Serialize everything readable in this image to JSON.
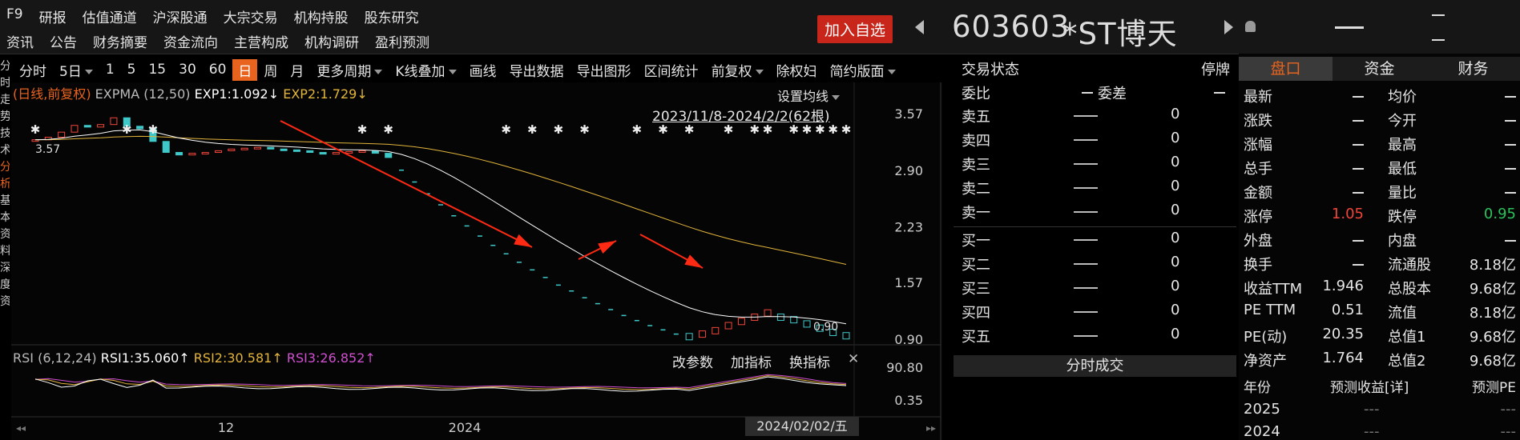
{
  "menu": {
    "row1": [
      "F9",
      "研报",
      "估值通道",
      "沪深股通",
      "大宗交易",
      "机构持股",
      "股东研究"
    ],
    "row2": [
      "资讯",
      "公告",
      "财务摘要",
      "资金流向",
      "主营构成",
      "机构调研",
      "盈利预测"
    ]
  },
  "header": {
    "add_fav": "加入自选",
    "code": "603603",
    "name": "*ST博天"
  },
  "toolbar": {
    "items": [
      "分时",
      "5日",
      "1",
      "5",
      "15",
      "30",
      "60",
      "日",
      "周",
      "月",
      "更多周期",
      "K线叠加",
      "画线",
      "导出数据",
      "导出图形",
      "区间统计",
      "前复权",
      "除权妇",
      "简约版面"
    ],
    "active": "日"
  },
  "side_tabs": [
    "分",
    "时",
    "走",
    "势",
    "技",
    "术",
    "分",
    "析",
    "基",
    "本",
    "资",
    "料",
    "深",
    "度",
    "资"
  ],
  "chart": {
    "k_indicator": {
      "mode": "(日线,前复权)",
      "name": "EXPMA",
      "params": "(12,50)",
      "exp1": "EXP1:1.092↓",
      "exp2": "EXP2:1.729↓"
    },
    "set_ma": "设置均线",
    "range": "2023/11/8-2024/2/2(62根)",
    "price_ticks": [
      "3.57",
      "2.90",
      "2.23",
      "1.57",
      "0.90"
    ],
    "low_label": "0.90",
    "high_label": "3.57",
    "rsi_indicator": {
      "name": "RSI",
      "params": "(6,12,24)",
      "rsi1": "RSI1:35.060↑",
      "rsi2": "RSI2:30.581↑",
      "rsi3": "RSI3:26.852↑"
    },
    "rsi_tools": [
      "改参数",
      "加指标",
      "换指标"
    ],
    "rsi_ticks": [
      "90.80",
      "0.35"
    ],
    "x_labels": [
      "12",
      "2024"
    ],
    "date_tip": "2024/02/02/五",
    "colors": {
      "exp1": "#ffffff",
      "exp2": "#e2b43a",
      "rsi2": "#e2b43a",
      "rsi3": "#d04fd0",
      "up": "#f0453a",
      "down": "#3fc8c8",
      "arrow": "#ff2a14"
    }
  },
  "chart_data": {
    "type": "candlestick",
    "x": [
      "2023/11/8",
      "2024/2/2"
    ],
    "y_range": [
      0.9,
      3.57
    ],
    "exp1_last": 1.092,
    "exp2_last": 1.729,
    "rsi": {
      "rsi1": 35.06,
      "rsi2": 30.581,
      "rsi3": 26.852
    },
    "closes": [
      3.27,
      3.3,
      3.36,
      3.44,
      3.42,
      3.45,
      3.53,
      3.43,
      3.4,
      3.25,
      3.12,
      3.09,
      3.11,
      3.12,
      3.14,
      3.16,
      3.17,
      3.18,
      3.16,
      3.15,
      3.14,
      3.12,
      3.1,
      3.12,
      3.13,
      3.14,
      3.11,
      3.06,
      2.91,
      2.77,
      2.63,
      2.5,
      2.37,
      2.25,
      2.13,
      2.02,
      1.92,
      1.82,
      1.73,
      1.64,
      1.55,
      1.48,
      1.4,
      1.33,
      1.26,
      1.19,
      1.13,
      1.07,
      1.02,
      0.97,
      0.94,
      0.97,
      1.01,
      1.07,
      1.12,
      1.17,
      1.22,
      1.17,
      1.14,
      1.09,
      1.04,
      0.99,
      0.95
    ]
  },
  "orderbook": {
    "status_label": "交易状态",
    "status": "停牌",
    "weibi": "委比",
    "weicha": "委差",
    "rows": [
      {
        "label": "卖五",
        "vol": "0"
      },
      {
        "label": "卖四",
        "vol": "0"
      },
      {
        "label": "卖三",
        "vol": "0"
      },
      {
        "label": "卖二",
        "vol": "0"
      },
      {
        "label": "卖一",
        "vol": "0"
      },
      {
        "label": "买一",
        "vol": "0"
      },
      {
        "label": "买二",
        "vol": "0"
      },
      {
        "label": "买三",
        "vol": "0"
      },
      {
        "label": "买四",
        "vol": "0"
      },
      {
        "label": "买五",
        "vol": "0"
      }
    ],
    "tick_title": "分时成交"
  },
  "quote": {
    "tabs": [
      "盘口",
      "资金",
      "财务"
    ],
    "rows": [
      {
        "k1": "最新",
        "v1": "",
        "k2": "均价",
        "v2": ""
      },
      {
        "k1": "涨跌",
        "v1": "",
        "k2": "今开",
        "v2": ""
      },
      {
        "k1": "涨幅",
        "v1": "",
        "k2": "最高",
        "v2": ""
      },
      {
        "k1": "总手",
        "v1": "",
        "k2": "最低",
        "v2": ""
      },
      {
        "k1": "金额",
        "v1": "",
        "k2": "量比",
        "v2": ""
      },
      {
        "k1": "涨停",
        "v1": "1.05",
        "k2": "跌停",
        "v2": "0.95"
      },
      {
        "k1": "外盘",
        "v1": "",
        "k2": "内盘",
        "v2": ""
      },
      {
        "k1": "换手",
        "v1": "",
        "k2": "流通股",
        "v2": "8.18亿"
      },
      {
        "k1": "收益TTM",
        "v1": "1.946",
        "k2": "总股本",
        "v2": "9.68亿"
      },
      {
        "k1": "PE TTM",
        "v1": "0.51",
        "k2": "流值",
        "v2": "8.18亿"
      },
      {
        "k1": "PE(动)",
        "v1": "20.35",
        "k2": "总值1",
        "v2": "9.68亿"
      },
      {
        "k1": "净资产",
        "v1": "1.764",
        "k2": "总值2",
        "v2": "9.68亿"
      }
    ],
    "forecast_head": {
      "year": "年份",
      "eps": "预测收益[详]",
      "pe": "预测PE"
    },
    "forecast": [
      {
        "year": "2025",
        "eps": "---",
        "pe": "---"
      },
      {
        "year": "2024",
        "eps": "---",
        "pe": "---"
      }
    ]
  }
}
